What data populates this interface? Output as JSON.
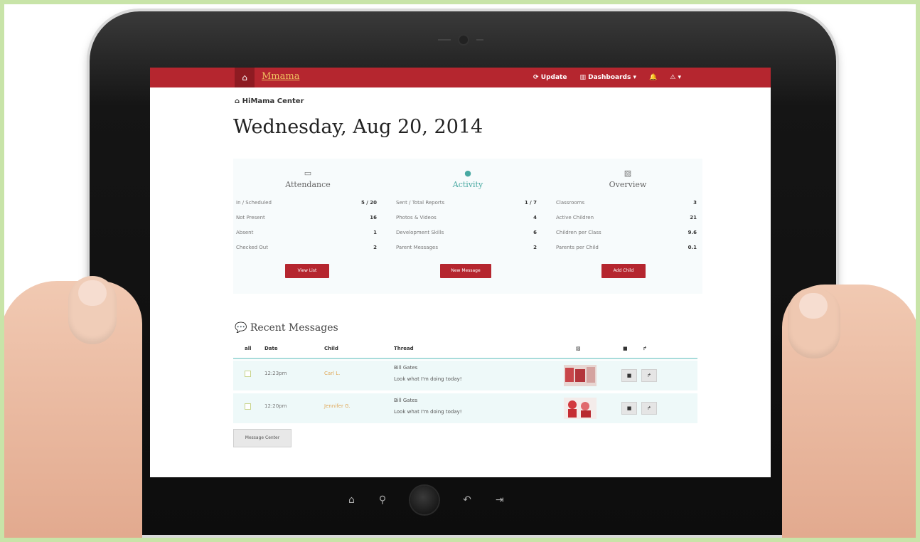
{
  "navbar": {
    "brand": "Mmama",
    "update": "Update",
    "dashboards": "Dashboards",
    "dashboards_caret": "▾",
    "alert_caret": "▾"
  },
  "header": {
    "center_name": "HiMama Center",
    "date_title": "Wednesday, Aug 20, 2014"
  },
  "panels": [
    {
      "title": "Attendance",
      "icon": "calendar-icon",
      "stats": [
        {
          "label": "In / Scheduled",
          "value": "5 / 20"
        },
        {
          "label": "Not Present",
          "value": "16"
        },
        {
          "label": "Absent",
          "value": "1"
        },
        {
          "label": "Checked Out",
          "value": "2"
        }
      ],
      "button": "View List"
    },
    {
      "title": "Activity",
      "icon": "globe-icon",
      "stats": [
        {
          "label": "Sent / Total Reports",
          "value": "1 / 7"
        },
        {
          "label": "Photos & Videos",
          "value": "4"
        },
        {
          "label": "Development Skills",
          "value": "6"
        },
        {
          "label": "Parent Messages",
          "value": "2"
        }
      ],
      "button": "New Message"
    },
    {
      "title": "Overview",
      "icon": "image-icon",
      "stats": [
        {
          "label": "Classrooms",
          "value": "3"
        },
        {
          "label": "Active Children",
          "value": "21"
        },
        {
          "label": "Children per Class",
          "value": "9.6"
        },
        {
          "label": "Parents per Child",
          "value": "0.1"
        }
      ],
      "button": "Add Child"
    }
  ],
  "messages": {
    "heading": "Recent Messages",
    "columns": {
      "all": "all",
      "date": "Date",
      "child": "Child",
      "thread": "Thread"
    },
    "rows": [
      {
        "time": "12:23pm",
        "child": "Carl L.",
        "from": "Bill Gates",
        "text": "Look what I'm doing today!"
      },
      {
        "time": "12:20pm",
        "child": "Jennifer G.",
        "from": "Bill Gates",
        "text": "Look what I'm doing today!"
      }
    ],
    "center_button": "Message Center"
  },
  "colors": {
    "navbar": "#b5262f",
    "accent": "#48a9a2",
    "button": "#b5262f",
    "row_bg": "#eef9f9"
  }
}
